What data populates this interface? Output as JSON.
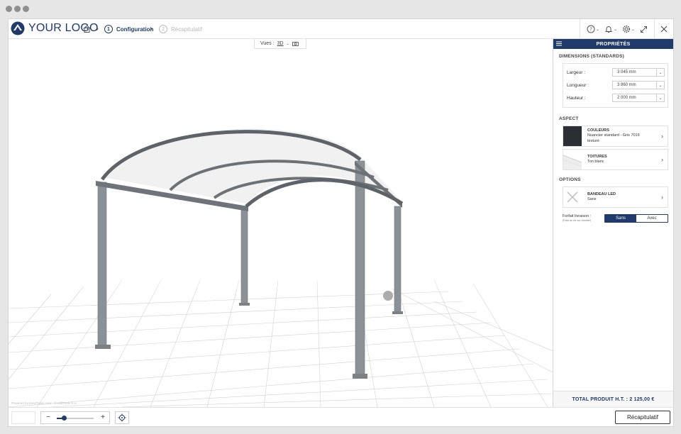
{
  "brand": {
    "logo_text": "YOUR LOGO",
    "primary_color": "#1f3a6b"
  },
  "breadcrumb": {
    "home_icon": "home-icon",
    "steps": [
      {
        "number": "1",
        "label": "Configuration",
        "state": "active"
      },
      {
        "number": "2",
        "label": "Récapitulatif",
        "state": "inactive"
      }
    ]
  },
  "toolbar": {
    "help_icon": "help-circle-icon",
    "notification_icon": "bell-icon",
    "settings_icon": "gear-icon",
    "fullscreen_icon": "expand-icon",
    "close_icon": "close-icon"
  },
  "viewer": {
    "views_label": "Vues :",
    "views_value": "3D",
    "camera_icon": "camera-icon",
    "copyright": "Powered by EasyTrans.com - © AddTools S.A."
  },
  "bottom": {
    "zoom_out_label": "−",
    "zoom_in_label": "+",
    "zoom_level": 0.2,
    "center_icon": "target-icon",
    "summary_button": "Récapitulatif"
  },
  "panel": {
    "title": "PROPRIÉTÉS",
    "dimensions": {
      "title": "DIMENSIONS (STANDARDS)",
      "rows": [
        {
          "label": "Largeur :",
          "value": "3 045 mm"
        },
        {
          "label": "Longueur :",
          "value": "3 860 mm"
        },
        {
          "label": "Hauteur :",
          "value": "2 000 mm"
        }
      ]
    },
    "aspect": {
      "title": "ASPECT",
      "colors": {
        "title": "COULEURS",
        "line1": "Nuancier standard - Gris 7016",
        "line2": "texturé",
        "swatch": "#2b2f33"
      },
      "roof": {
        "title": "TOITURES",
        "line1": "Ton blanc"
      }
    },
    "options": {
      "title": "OPTIONS",
      "led": {
        "title": "BANDEAU LED",
        "line1": "Sans"
      },
      "delivery": {
        "label": "Forfait livraison :",
        "note": "(Frais de rdv sur chantier)",
        "options": [
          "Sans",
          "Avec"
        ],
        "selected": "Sans"
      }
    },
    "total": "TOTAL PRODUIT H.T. : 2 125,00 €"
  }
}
